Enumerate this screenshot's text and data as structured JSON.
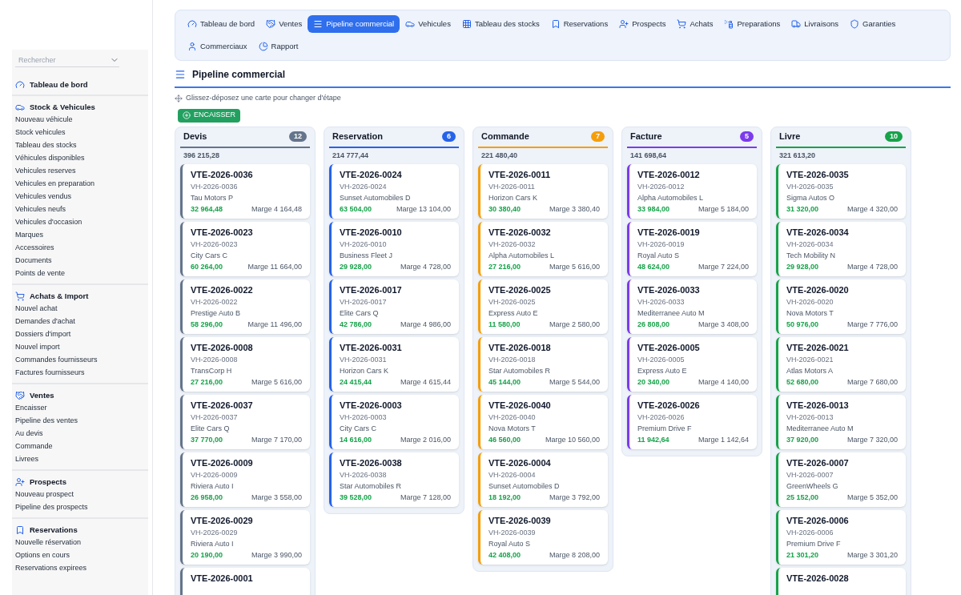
{
  "nav": {
    "tabs": [
      {
        "label": "Tableau de bord",
        "selected": false
      },
      {
        "label": "Ventes",
        "selected": false
      },
      {
        "label": "Pipeline commercial",
        "selected": true
      },
      {
        "label": "Vehicules",
        "selected": false
      },
      {
        "label": "Tableau des stocks",
        "selected": false
      },
      {
        "label": "Reservations",
        "selected": false
      },
      {
        "label": "Prospects",
        "selected": false
      },
      {
        "label": "Achats",
        "selected": false
      },
      {
        "label": "Preparations",
        "selected": false
      },
      {
        "label": "Livraisons",
        "selected": false
      },
      {
        "label": "Garanties",
        "selected": false
      },
      {
        "label": "Commerciaux",
        "selected": false
      },
      {
        "label": "Rapport",
        "selected": false
      }
    ]
  },
  "sidebar": {
    "search": {
      "placeholder": "Rechercher"
    },
    "sections": [
      {
        "title": "Tableau de bord"
      },
      {
        "title": "Stock & Vehicules",
        "items": [
          "Nouveau véhicule",
          "Stock vehicules",
          "Tableau des stocks",
          "Véhicules disponibles",
          "Vehicules reserves",
          "Vehicules en preparation",
          "Vehicules vendus",
          "Vehicules neufs",
          "Vehicules d'occasion",
          "Marques",
          "Accessoires",
          "Documents",
          "Points de vente"
        ]
      },
      {
        "title": "Achats & Import",
        "items": [
          "Nouvel achat",
          "Demandes d'achat",
          "Dossiers d'import",
          "Nouvel import",
          "Commandes fournisseurs",
          "Factures fournisseurs"
        ]
      },
      {
        "title": "Ventes",
        "items": [
          "Encaisser",
          "Pipeline des ventes",
          "Au devis",
          "Commande",
          "Livrees"
        ]
      },
      {
        "title": "Prospects",
        "items": [
          "Nouveau prospect",
          "Pipeline des prospects"
        ]
      },
      {
        "title": "Reservations",
        "items": [
          "Nouvelle réservation",
          "Options en cours",
          "Reservations expirees"
        ]
      }
    ]
  },
  "page": {
    "title": "Pipeline commercial",
    "hint": "Glissez-déposez une carte pour changer d'étape",
    "action_button": "ENCAISSER"
  },
  "columns": [
    {
      "title": "Devis",
      "count": "12",
      "total": "396 215,28",
      "color": "#64748b",
      "cards": [
        {
          "ref": "VTE-2026-0036",
          "vehicle": "VH-2026-0036",
          "client": "Tau Motors P",
          "amount": "32 964,48",
          "margin": "Marge 4 164,48"
        },
        {
          "ref": "VTE-2026-0023",
          "vehicle": "VH-2026-0023",
          "client": "City Cars C",
          "amount": "60 264,00",
          "margin": "Marge 11 664,00"
        },
        {
          "ref": "VTE-2026-0022",
          "vehicle": "VH-2026-0022",
          "client": "Prestige Auto B",
          "amount": "58 296,00",
          "margin": "Marge 11 496,00"
        },
        {
          "ref": "VTE-2026-0008",
          "vehicle": "VH-2026-0008",
          "client": "TransCorp H",
          "amount": "27 216,00",
          "margin": "Marge 5 616,00"
        },
        {
          "ref": "VTE-2026-0037",
          "vehicle": "VH-2026-0037",
          "client": "Elite Cars Q",
          "amount": "37 770,00",
          "margin": "Marge 7 170,00"
        },
        {
          "ref": "VTE-2026-0009",
          "vehicle": "VH-2026-0009",
          "client": "Riviera Auto I",
          "amount": "26 958,00",
          "margin": "Marge 3 558,00"
        },
        {
          "ref": "VTE-2026-0029",
          "vehicle": "VH-2026-0029",
          "client": "Riviera Auto I",
          "amount": "20 190,00",
          "margin": "Marge 3 990,00"
        },
        {
          "ref": "VTE-2026-0001"
        }
      ]
    },
    {
      "title": "Reservation",
      "count": "6",
      "total": "214 777,44",
      "color": "#2563eb",
      "cards": [
        {
          "ref": "VTE-2026-0024",
          "vehicle": "VH-2026-0024",
          "client": "Sunset Automobiles D",
          "amount": "63 504,00",
          "margin": "Marge 13 104,00"
        },
        {
          "ref": "VTE-2026-0010",
          "vehicle": "VH-2026-0010",
          "client": "Business Fleet J",
          "amount": "29 928,00",
          "margin": "Marge 4 728,00"
        },
        {
          "ref": "VTE-2026-0017",
          "vehicle": "VH-2026-0017",
          "client": "Elite Cars Q",
          "amount": "42 786,00",
          "margin": "Marge 4 986,00"
        },
        {
          "ref": "VTE-2026-0031",
          "vehicle": "VH-2026-0031",
          "client": "Horizon Cars K",
          "amount": "24 415,44",
          "margin": "Marge 4 615,44"
        },
        {
          "ref": "VTE-2026-0003",
          "vehicle": "VH-2026-0003",
          "client": "City Cars C",
          "amount": "14 616,00",
          "margin": "Marge 2 016,00"
        },
        {
          "ref": "VTE-2026-0038",
          "vehicle": "VH-2026-0038",
          "client": "Star Automobiles R",
          "amount": "39 528,00",
          "margin": "Marge 7 128,00"
        }
      ]
    },
    {
      "title": "Commande",
      "count": "7",
      "total": "221 480,40",
      "color": "#f59e0b",
      "cards": [
        {
          "ref": "VTE-2026-0011",
          "vehicle": "VH-2026-0011",
          "client": "Horizon Cars K",
          "amount": "30 380,40",
          "margin": "Marge 3 380,40"
        },
        {
          "ref": "VTE-2026-0032",
          "vehicle": "VH-2026-0032",
          "client": "Alpha Automobiles L",
          "amount": "27 216,00",
          "margin": "Marge 5 616,00"
        },
        {
          "ref": "VTE-2026-0025",
          "vehicle": "VH-2026-0025",
          "client": "Express Auto E",
          "amount": "11 580,00",
          "margin": "Marge 2 580,00"
        },
        {
          "ref": "VTE-2026-0018",
          "vehicle": "VH-2026-0018",
          "client": "Star Automobiles R",
          "amount": "45 144,00",
          "margin": "Marge 5 544,00"
        },
        {
          "ref": "VTE-2026-0040",
          "vehicle": "VH-2026-0040",
          "client": "Nova Motors T",
          "amount": "46 560,00",
          "margin": "Marge 10 560,00"
        },
        {
          "ref": "VTE-2026-0004",
          "vehicle": "VH-2026-0004",
          "client": "Sunset Automobiles D",
          "amount": "18 192,00",
          "margin": "Marge 3 792,00"
        },
        {
          "ref": "VTE-2026-0039",
          "vehicle": "VH-2026-0039",
          "client": "Royal Auto S",
          "amount": "42 408,00",
          "margin": "Marge 8 208,00"
        }
      ]
    },
    {
      "title": "Facture",
      "count": "5",
      "total": "141 698,64",
      "color": "#7c3aed",
      "cards": [
        {
          "ref": "VTE-2026-0012",
          "vehicle": "VH-2026-0012",
          "client": "Alpha Automobiles L",
          "amount": "33 984,00",
          "margin": "Marge 5 184,00"
        },
        {
          "ref": "VTE-2026-0019",
          "vehicle": "VH-2026-0019",
          "client": "Royal Auto S",
          "amount": "48 624,00",
          "margin": "Marge 7 224,00"
        },
        {
          "ref": "VTE-2026-0033",
          "vehicle": "VH-2026-0033",
          "client": "Mediterranee Auto M",
          "amount": "26 808,00",
          "margin": "Marge 3 408,00"
        },
        {
          "ref": "VTE-2026-0005",
          "vehicle": "VH-2026-0005",
          "client": "Express Auto E",
          "amount": "20 340,00",
          "margin": "Marge 4 140,00"
        },
        {
          "ref": "VTE-2026-0026",
          "vehicle": "VH-2026-0026",
          "client": "Premium Drive F",
          "amount": "11 942,64",
          "margin": "Marge 1 142,64"
        }
      ]
    },
    {
      "title": "Livre",
      "count": "10",
      "total": "321 613,20",
      "color": "#16a34a",
      "cards": [
        {
          "ref": "VTE-2026-0035",
          "vehicle": "VH-2026-0035",
          "client": "Sigma Autos O",
          "amount": "31 320,00",
          "margin": "Marge 4 320,00"
        },
        {
          "ref": "VTE-2026-0034",
          "vehicle": "VH-2026-0034",
          "client": "Tech Mobility N",
          "amount": "29 928,00",
          "margin": "Marge 4 728,00"
        },
        {
          "ref": "VTE-2026-0020",
          "vehicle": "VH-2026-0020",
          "client": "Nova Motors T",
          "amount": "50 976,00",
          "margin": "Marge 7 776,00"
        },
        {
          "ref": "VTE-2026-0021",
          "vehicle": "VH-2026-0021",
          "client": "Atlas Motors A",
          "amount": "52 680,00",
          "margin": "Marge 7 680,00"
        },
        {
          "ref": "VTE-2026-0013",
          "vehicle": "VH-2026-0013",
          "client": "Mediterranee Auto M",
          "amount": "37 920,00",
          "margin": "Marge 7 320,00"
        },
        {
          "ref": "VTE-2026-0007",
          "vehicle": "VH-2026-0007",
          "client": "GreenWheels G",
          "amount": "25 152,00",
          "margin": "Marge 5 352,00"
        },
        {
          "ref": "VTE-2026-0006",
          "vehicle": "VH-2026-0006",
          "client": "Premium Drive F",
          "amount": "21 301,20",
          "margin": "Marge 3 301,20"
        },
        {
          "ref": "VTE-2026-0028"
        }
      ]
    }
  ]
}
